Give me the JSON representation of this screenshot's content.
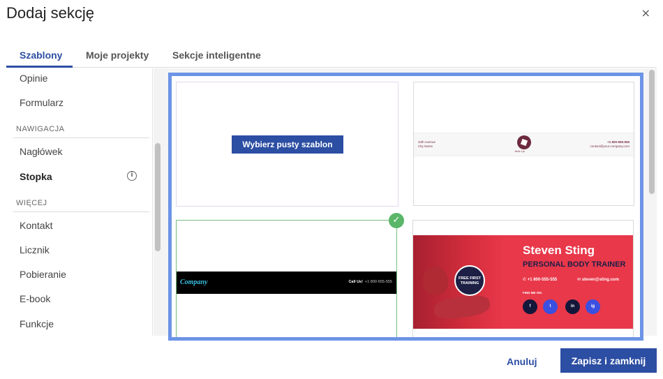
{
  "dialog": {
    "title": "Dodaj sekcję",
    "close_icon": "close-icon",
    "close_glyph": "×"
  },
  "tabs": [
    {
      "label": "Szablony",
      "active": true
    },
    {
      "label": "Moje projekty",
      "active": false
    },
    {
      "label": "Sekcje inteligentne",
      "active": false
    }
  ],
  "sidebar": {
    "items_top": [
      "Opinie",
      "Formularz"
    ],
    "group_nav": {
      "heading": "NAWIGACJA",
      "items": [
        "Nagłówek",
        "Stopka"
      ]
    },
    "group_more": {
      "heading": "WIĘCEJ",
      "items": [
        "Kontakt",
        "Licznik",
        "Pobieranie",
        "E-book",
        "Funkcje"
      ]
    },
    "selected": "Stopka",
    "info_icon": "info-icon",
    "info_glyph": "i"
  },
  "gallery": {
    "accent_color": "#6c94e6",
    "blank_template_button": "Wybierz pusty szablon",
    "template2": {
      "address_line1": "34th Avenue",
      "address_line2": "City Name",
      "logo_caption": "Jedz Lip",
      "phone": "+1 800-555-555",
      "email": "contact@your.company.com"
    },
    "template3": {
      "brand": "Company",
      "call_label": "Call Us!",
      "phone": "+1 800-555-555",
      "selected": true,
      "check_icon": "check-icon",
      "check_glyph": "✓"
    },
    "template4": {
      "badge_line1": "FREE FIRST",
      "badge_line2": "TRAINING",
      "name": "Steven Sting",
      "role": "PERSONAL BODY TRAINER",
      "phone": "+1 800-555-555",
      "email": "steven@sting.com",
      "find_label": "FIND ME ON:",
      "social": [
        "f",
        "t",
        "in",
        "ig"
      ],
      "phone_glyph": "✆",
      "mail_glyph": "✉"
    }
  },
  "footer": {
    "cancel_label": "Anuluj",
    "save_label": "Zapisz i zamknij"
  },
  "colors": {
    "primary": "#2c4ea3",
    "selection_border": "#6c94e6",
    "check_green": "#5ab669",
    "promo_red": "#e8384a"
  }
}
